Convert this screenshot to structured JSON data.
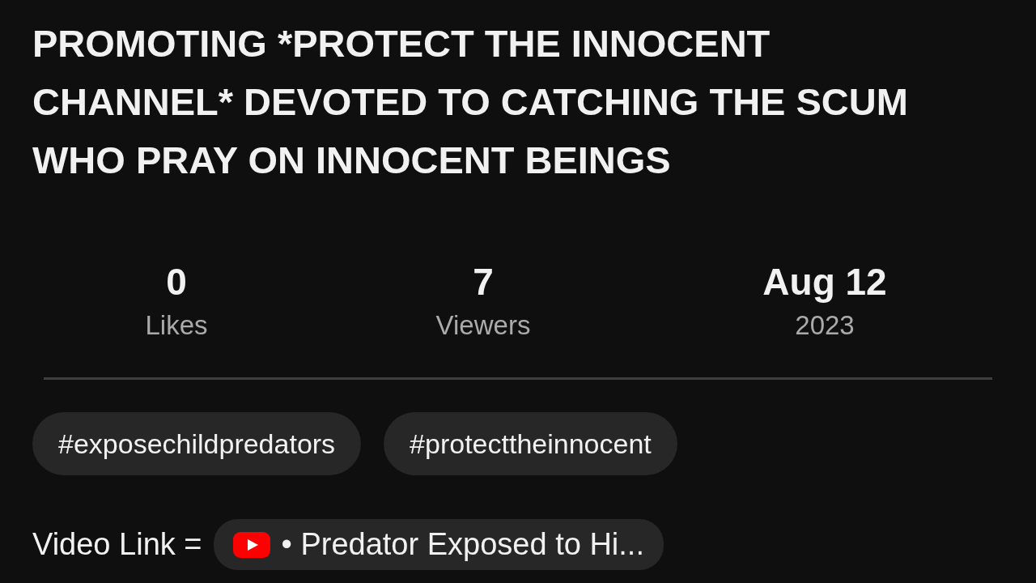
{
  "title": "PROMOTING *PROTECT THE INNOCENT CHANNEL* DEVOTED TO CATCHING THE SCUM WHO PRAY ON INNOCENT BEINGS",
  "stats": [
    {
      "value": "0",
      "label": "Likes"
    },
    {
      "value": "7",
      "label": "Viewers"
    },
    {
      "value": "Aug 12",
      "label": "2023"
    }
  ],
  "tags": [
    "#exposechildpredators",
    "#protecttheinnocent"
  ],
  "video_link": {
    "label": "Video Link =",
    "chip_text": "• Predator Exposed to Hi..."
  }
}
